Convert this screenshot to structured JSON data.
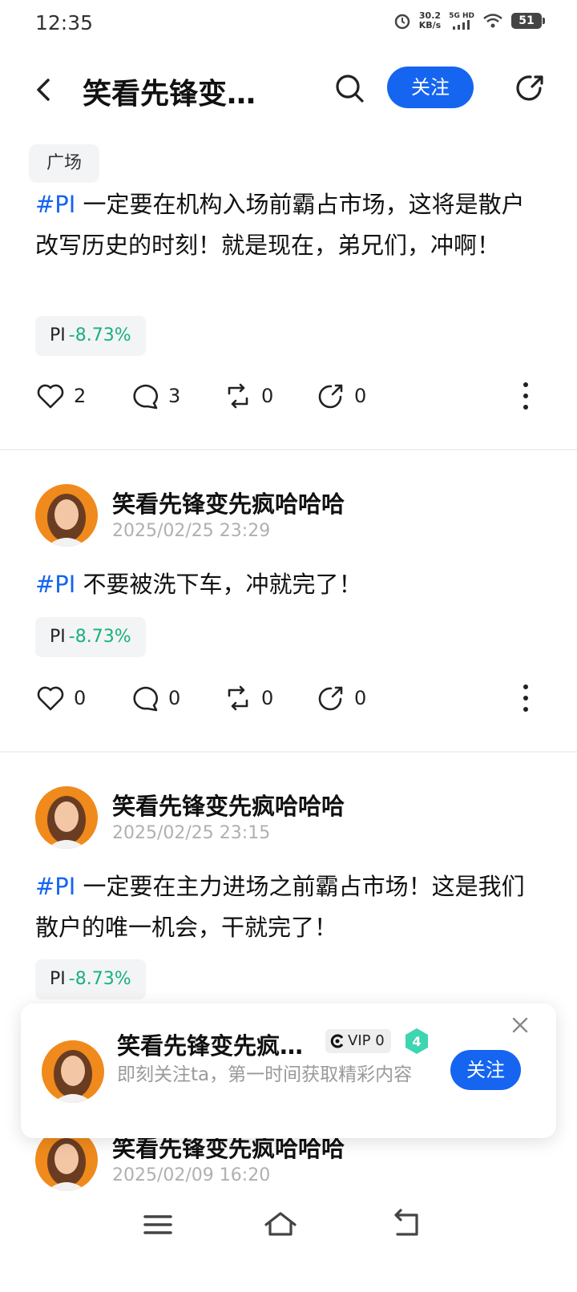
{
  "status_bar": {
    "time": "12:35",
    "speed_value": "30.2",
    "speed_unit": "KB/s",
    "network": "5G HD",
    "battery": "51"
  },
  "header": {
    "title": "笑看先锋变…",
    "follow_label": "关注",
    "icons": [
      "back-icon",
      "search-icon",
      "share-icon"
    ]
  },
  "posts": [
    {
      "tag": "广场",
      "hashtag": "#PI",
      "text": " 一定要在机构入场前霸占市场，这将是散户改写历史的时刻！就是现在，弟兄们，冲啊！",
      "stock": {
        "symbol": "PI",
        "change": "-8.73%"
      },
      "likes": "2",
      "comments": "3",
      "reposts": "0",
      "shares": "0"
    },
    {
      "author": "笑看先锋变先疯哈哈哈",
      "time": "2025/02/25 23:29",
      "hashtag": "#PI",
      "text": " 不要被洗下车，冲就完了！",
      "stock": {
        "symbol": "PI",
        "change": "-8.73%"
      },
      "likes": "0",
      "comments": "0",
      "reposts": "0",
      "shares": "0"
    },
    {
      "author": "笑看先锋变先疯哈哈哈",
      "time": "2025/02/25 23:15",
      "hashtag": "#PI",
      "text": " 一定要在主力进场之前霸占市场！这是我们散户的唯一机会，干就完了！",
      "stock": {
        "symbol": "PI",
        "change": "-8.73%"
      }
    },
    {
      "author": "笑看先锋变先疯哈哈哈",
      "time": "2025/02/09 16:20"
    }
  ],
  "popup": {
    "name": "笑看先锋变先疯…",
    "vip": "VIP 0",
    "level": "4",
    "description": "即刻关注ta，第一时间获取精彩内容",
    "follow_label": "关注"
  },
  "colors": {
    "accent": "#1565f0",
    "positive_change": "#17b27a",
    "muted_text": "#b0b0b0"
  }
}
